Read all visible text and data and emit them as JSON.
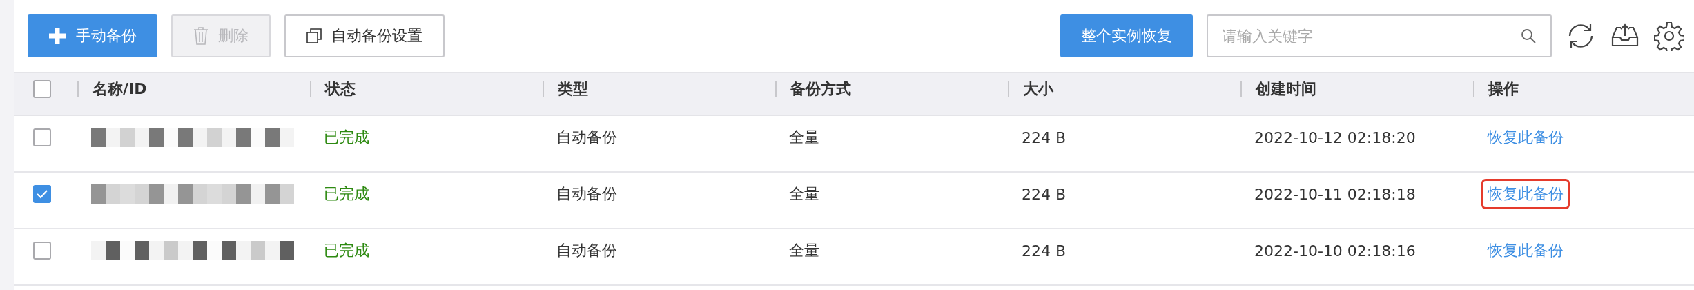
{
  "toolbar": {
    "add_button": "手动备份",
    "delete_button": {
      "label": "删除",
      "disabled": true
    },
    "settings_button": "自动备份设置",
    "restore_all_button": "整个实例恢复",
    "search": {
      "placeholder": "请输入关键字"
    }
  },
  "table": {
    "select_all": {
      "checked": false
    },
    "columns": [
      "名称/ID",
      "状态",
      "类型",
      "备份方式",
      "大小",
      "创建时间",
      "操作"
    ],
    "rows": [
      {
        "selected": false,
        "status": "已完成",
        "type": "自动备份",
        "method": "全量",
        "size": "224 B",
        "created": "2022-10-12 02:18:20",
        "action": "恢复此备份",
        "highlighted": false
      },
      {
        "selected": true,
        "status": "已完成",
        "type": "自动备份",
        "method": "全量",
        "size": "224 B",
        "created": "2022-10-11 02:18:18",
        "action": "恢复此备份",
        "highlighted": true
      },
      {
        "selected": false,
        "status": "已完成",
        "type": "自动备份",
        "method": "全量",
        "size": "224 B",
        "created": "2022-10-10 02:18:16",
        "action": "恢复此备份",
        "highlighted": false
      }
    ]
  }
}
